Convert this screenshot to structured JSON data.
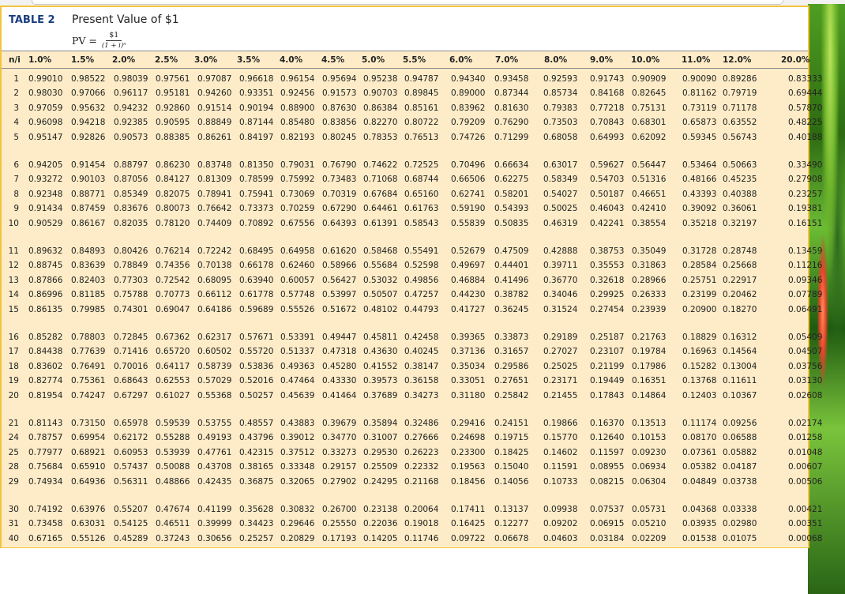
{
  "table": {
    "label": "TABLE 2",
    "title": "Present Value of $1",
    "formula_lhs": "PV =",
    "formula_num": "$1",
    "formula_den": "(1 + i)ⁿ",
    "headers": [
      "n/i",
      "1.0%",
      "1.5%",
      "2.0%",
      "2.5%",
      "3.0%",
      "3.5%",
      "4.0%",
      "4.5%",
      "5.0%",
      "5.5%",
      "6.0%",
      "7.0%",
      "8.0%",
      "9.0%",
      "10.0%",
      "11.0%",
      "12.0%",
      "20.0%"
    ],
    "rows": [
      [
        "1",
        "0.99010",
        "0.98522",
        "0.98039",
        "0.97561",
        "0.97087",
        "0.96618",
        "0.96154",
        "0.95694",
        "0.95238",
        "0.94787",
        "0.94340",
        "0.93458",
        "0.92593",
        "0.91743",
        "0.90909",
        "0.90090",
        "0.89286",
        "0.83333"
      ],
      [
        "2",
        "0.98030",
        "0.97066",
        "0.96117",
        "0.95181",
        "0.94260",
        "0.93351",
        "0.92456",
        "0.91573",
        "0.90703",
        "0.89845",
        "0.89000",
        "0.87344",
        "0.85734",
        "0.84168",
        "0.82645",
        "0.81162",
        "0.79719",
        "0.69444"
      ],
      [
        "3",
        "0.97059",
        "0.95632",
        "0.94232",
        "0.92860",
        "0.91514",
        "0.90194",
        "0.88900",
        "0.87630",
        "0.86384",
        "0.85161",
        "0.83962",
        "0.81630",
        "0.79383",
        "0.77218",
        "0.75131",
        "0.73119",
        "0.71178",
        "0.57870"
      ],
      [
        "4",
        "0.96098",
        "0.94218",
        "0.92385",
        "0.90595",
        "0.88849",
        "0.87144",
        "0.85480",
        "0.83856",
        "0.82270",
        "0.80722",
        "0.79209",
        "0.76290",
        "0.73503",
        "0.70843",
        "0.68301",
        "0.65873",
        "0.63552",
        "0.48225"
      ],
      [
        "5",
        "0.95147",
        "0.92826",
        "0.90573",
        "0.88385",
        "0.86261",
        "0.84197",
        "0.82193",
        "0.80245",
        "0.78353",
        "0.76513",
        "0.74726",
        "0.71299",
        "0.68058",
        "0.64993",
        "0.62092",
        "0.59345",
        "0.56743",
        "0.40188"
      ],
      [
        "6",
        "0.94205",
        "0.91454",
        "0.88797",
        "0.86230",
        "0.83748",
        "0.81350",
        "0.79031",
        "0.76790",
        "0.74622",
        "0.72525",
        "0.70496",
        "0.66634",
        "0.63017",
        "0.59627",
        "0.56447",
        "0.53464",
        "0.50663",
        "0.33490"
      ],
      [
        "7",
        "0.93272",
        "0.90103",
        "0.87056",
        "0.84127",
        "0.81309",
        "0.78599",
        "0.75992",
        "0.73483",
        "0.71068",
        "0.68744",
        "0.66506",
        "0.62275",
        "0.58349",
        "0.54703",
        "0.51316",
        "0.48166",
        "0.45235",
        "0.27908"
      ],
      [
        "8",
        "0.92348",
        "0.88771",
        "0.85349",
        "0.82075",
        "0.78941",
        "0.75941",
        "0.73069",
        "0.70319",
        "0.67684",
        "0.65160",
        "0.62741",
        "0.58201",
        "0.54027",
        "0.50187",
        "0.46651",
        "0.43393",
        "0.40388",
        "0.23257"
      ],
      [
        "9",
        "0.91434",
        "0.87459",
        "0.83676",
        "0.80073",
        "0.76642",
        "0.73373",
        "0.70259",
        "0.67290",
        "0.64461",
        "0.61763",
        "0.59190",
        "0.54393",
        "0.50025",
        "0.46043",
        "0.42410",
        "0.39092",
        "0.36061",
        "0.19381"
      ],
      [
        "10",
        "0.90529",
        "0.86167",
        "0.82035",
        "0.78120",
        "0.74409",
        "0.70892",
        "0.67556",
        "0.64393",
        "0.61391",
        "0.58543",
        "0.55839",
        "0.50835",
        "0.46319",
        "0.42241",
        "0.38554",
        "0.35218",
        "0.32197",
        "0.16151"
      ],
      [
        "11",
        "0.89632",
        "0.84893",
        "0.80426",
        "0.76214",
        "0.72242",
        "0.68495",
        "0.64958",
        "0.61620",
        "0.58468",
        "0.55491",
        "0.52679",
        "0.47509",
        "0.42888",
        "0.38753",
        "0.35049",
        "0.31728",
        "0.28748",
        "0.13459"
      ],
      [
        "12",
        "0.88745",
        "0.83639",
        "0.78849",
        "0.74356",
        "0.70138",
        "0.66178",
        "0.62460",
        "0.58966",
        "0.55684",
        "0.52598",
        "0.49697",
        "0.44401",
        "0.39711",
        "0.35553",
        "0.31863",
        "0.28584",
        "0.25668",
        "0.11216"
      ],
      [
        "13",
        "0.87866",
        "0.82403",
        "0.77303",
        "0.72542",
        "0.68095",
        "0.63940",
        "0.60057",
        "0.56427",
        "0.53032",
        "0.49856",
        "0.46884",
        "0.41496",
        "0.36770",
        "0.32618",
        "0.28966",
        "0.25751",
        "0.22917",
        "0.09346"
      ],
      [
        "14",
        "0.86996",
        "0.81185",
        "0.75788",
        "0.70773",
        "0.66112",
        "0.61778",
        "0.57748",
        "0.53997",
        "0.50507",
        "0.47257",
        "0.44230",
        "0.38782",
        "0.34046",
        "0.29925",
        "0.26333",
        "0.23199",
        "0.20462",
        "0.07789"
      ],
      [
        "15",
        "0.86135",
        "0.79985",
        "0.74301",
        "0.69047",
        "0.64186",
        "0.59689",
        "0.55526",
        "0.51672",
        "0.48102",
        "0.44793",
        "0.41727",
        "0.36245",
        "0.31524",
        "0.27454",
        "0.23939",
        "0.20900",
        "0.18270",
        "0.06491"
      ],
      [
        "16",
        "0.85282",
        "0.78803",
        "0.72845",
        "0.67362",
        "0.62317",
        "0.57671",
        "0.53391",
        "0.49447",
        "0.45811",
        "0.42458",
        "0.39365",
        "0.33873",
        "0.29189",
        "0.25187",
        "0.21763",
        "0.18829",
        "0.16312",
        "0.05409"
      ],
      [
        "17",
        "0.84438",
        "0.77639",
        "0.71416",
        "0.65720",
        "0.60502",
        "0.55720",
        "0.51337",
        "0.47318",
        "0.43630",
        "0.40245",
        "0.37136",
        "0.31657",
        "0.27027",
        "0.23107",
        "0.19784",
        "0.16963",
        "0.14564",
        "0.04507"
      ],
      [
        "18",
        "0.83602",
        "0.76491",
        "0.70016",
        "0.64117",
        "0.58739",
        "0.53836",
        "0.49363",
        "0.45280",
        "0.41552",
        "0.38147",
        "0.35034",
        "0.29586",
        "0.25025",
        "0.21199",
        "0.17986",
        "0.15282",
        "0.13004",
        "0.03756"
      ],
      [
        "19",
        "0.82774",
        "0.75361",
        "0.68643",
        "0.62553",
        "0.57029",
        "0.52016",
        "0.47464",
        "0.43330",
        "0.39573",
        "0.36158",
        "0.33051",
        "0.27651",
        "0.23171",
        "0.19449",
        "0.16351",
        "0.13768",
        "0.11611",
        "0.03130"
      ],
      [
        "20",
        "0.81954",
        "0.74247",
        "0.67297",
        "0.61027",
        "0.55368",
        "0.50257",
        "0.45639",
        "0.41464",
        "0.37689",
        "0.34273",
        "0.31180",
        "0.25842",
        "0.21455",
        "0.17843",
        "0.14864",
        "0.12403",
        "0.10367",
        "0.02608"
      ],
      [
        "21",
        "0.81143",
        "0.73150",
        "0.65978",
        "0.59539",
        "0.53755",
        "0.48557",
        "0.43883",
        "0.39679",
        "0.35894",
        "0.32486",
        "0.29416",
        "0.24151",
        "0.19866",
        "0.16370",
        "0.13513",
        "0.11174",
        "0.09256",
        "0.02174"
      ],
      [
        "24",
        "0.78757",
        "0.69954",
        "0.62172",
        "0.55288",
        "0.49193",
        "0.43796",
        "0.39012",
        "0.34770",
        "0.31007",
        "0.27666",
        "0.24698",
        "0.19715",
        "0.15770",
        "0.12640",
        "0.10153",
        "0.08170",
        "0.06588",
        "0.01258"
      ],
      [
        "25",
        "0.77977",
        "0.68921",
        "0.60953",
        "0.53939",
        "0.47761",
        "0.42315",
        "0.37512",
        "0.33273",
        "0.29530",
        "0.26223",
        "0.23300",
        "0.18425",
        "0.14602",
        "0.11597",
        "0.09230",
        "0.07361",
        "0.05882",
        "0.01048"
      ],
      [
        "28",
        "0.75684",
        "0.65910",
        "0.57437",
        "0.50088",
        "0.43708",
        "0.38165",
        "0.33348",
        "0.29157",
        "0.25509",
        "0.22332",
        "0.19563",
        "0.15040",
        "0.11591",
        "0.08955",
        "0.06934",
        "0.05382",
        "0.04187",
        "0.00607"
      ],
      [
        "29",
        "0.74934",
        "0.64936",
        "0.56311",
        "0.48866",
        "0.42435",
        "0.36875",
        "0.32065",
        "0.27902",
        "0.24295",
        "0.21168",
        "0.18456",
        "0.14056",
        "0.10733",
        "0.08215",
        "0.06304",
        "0.04849",
        "0.03738",
        "0.00506"
      ],
      [
        "30",
        "0.74192",
        "0.63976",
        "0.55207",
        "0.47674",
        "0.41199",
        "0.35628",
        "0.30832",
        "0.26700",
        "0.23138",
        "0.20064",
        "0.17411",
        "0.13137",
        "0.09938",
        "0.07537",
        "0.05731",
        "0.04368",
        "0.03338",
        "0.00421"
      ],
      [
        "31",
        "0.73458",
        "0.63031",
        "0.54125",
        "0.46511",
        "0.39999",
        "0.34423",
        "0.29646",
        "0.25550",
        "0.22036",
        "0.19018",
        "0.16425",
        "0.12277",
        "0.09202",
        "0.06915",
        "0.05210",
        "0.03935",
        "0.02980",
        "0.00351"
      ],
      [
        "40",
        "0.67165",
        "0.55126",
        "0.45289",
        "0.37243",
        "0.30656",
        "0.25257",
        "0.20829",
        "0.17193",
        "0.14205",
        "0.11746",
        "0.09722",
        "0.06678",
        "0.04603",
        "0.03184",
        "0.02209",
        "0.01538",
        "0.01075",
        "0.00068"
      ]
    ]
  },
  "colors": {
    "panel_border": "#f5c23c",
    "table_fill": "#fdecc7",
    "label": "#1a3f82"
  }
}
